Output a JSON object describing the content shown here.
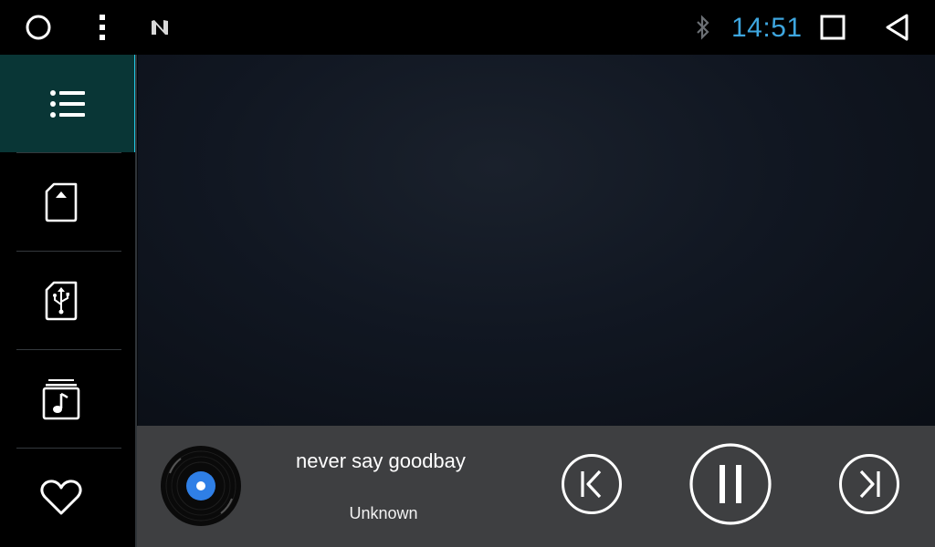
{
  "status_bar": {
    "time": "14:51",
    "icons": [
      "circle-home-icon",
      "more-vert-icon",
      "n-logo-icon",
      "bluetooth-icon",
      "square-recents-icon",
      "triangle-back-icon"
    ]
  },
  "sidebar": {
    "items": [
      {
        "icon": "playlist-icon",
        "active": true
      },
      {
        "icon": "sd-card-icon",
        "active": false
      },
      {
        "icon": "usb-storage-icon",
        "active": false
      },
      {
        "icon": "music-folder-icon",
        "active": false
      },
      {
        "icon": "heart-icon",
        "active": false
      }
    ]
  },
  "player": {
    "title": "never say goodbay",
    "artist": "Unknown",
    "state": "playing"
  },
  "colors": {
    "accent": "#22c9e5",
    "clock": "#3ea6df",
    "active_bg": "#093636",
    "player_bg": "#3e3f41",
    "disc_center": "#2f7fe6"
  }
}
